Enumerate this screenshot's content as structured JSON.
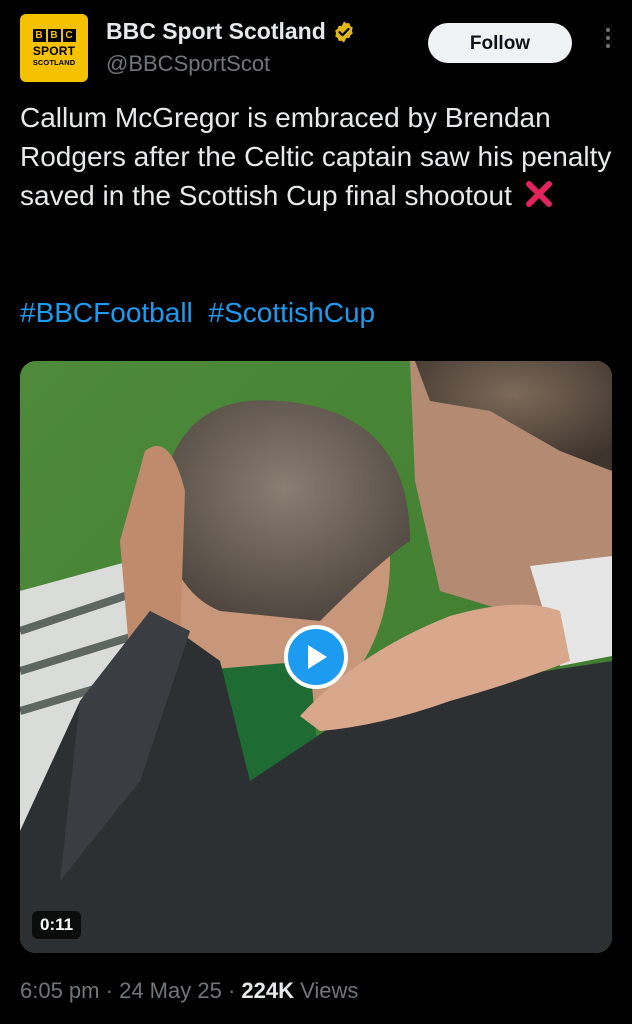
{
  "account": {
    "display_name": "BBC Sport Scotland",
    "handle": "@BBCSportScot",
    "avatar_letters": [
      "B",
      "B",
      "C"
    ],
    "avatar_line1": "SPORT",
    "avatar_line2": "SCOTLAND",
    "verified": true
  },
  "follow_button": {
    "label": "Follow"
  },
  "tweet": {
    "text": "Callum McGregor is embraced by Brendan Rodgers after the Celtic captain saw his penalty saved in the Scottish Cup final shootout",
    "emoji": "cross-mark-icon",
    "hashtags": [
      "#BBCFootball",
      "#ScottishCup"
    ]
  },
  "media": {
    "type": "video",
    "duration": "0:11"
  },
  "meta": {
    "time": "6:05 pm",
    "date": "24 May 25",
    "separator": "·",
    "views_count": "224K",
    "views_label": "Views"
  },
  "colors": {
    "background": "#000000",
    "text": "#e7e9ea",
    "secondary": "#71767b",
    "accent": "#1d9bf0",
    "verified_badge": "#e2b719",
    "avatar_bg": "#f6c200"
  }
}
